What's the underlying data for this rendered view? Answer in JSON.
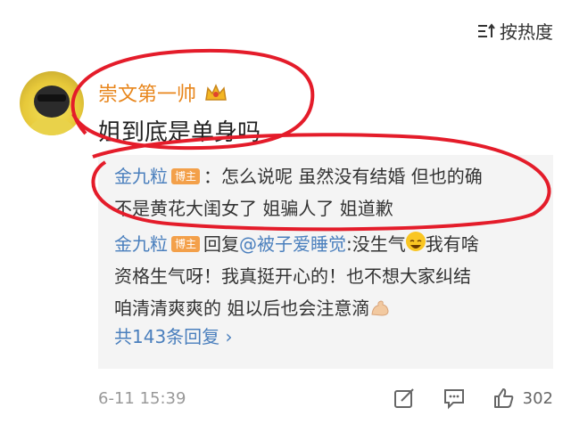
{
  "sort_button": {
    "label": "按热度",
    "icon": "sort-lines-icon"
  },
  "comment": {
    "avatar_icon": "avatar",
    "username": "崇文第一帅",
    "crown_icon": "crown-icon",
    "text": "姐到底是单身吗"
  },
  "replies": [
    {
      "name": "金九粒",
      "badge": "博主",
      "line1": "：怎么说呢 虽然没有结婚 但也的确",
      "line2": "不是黄花大闺女了 姐骗人了 姐道歉"
    },
    {
      "name": "金九粒",
      "badge": "博主",
      "reply_prefix": "回复",
      "mention": "@被子爱睡觉",
      "line1_tail": ":没生气",
      "line1_tail2": "我有啥",
      "line2": "资格生气呀！我真挺开心的！也不想大家纠结",
      "line3": "咱清清爽爽的 姐以后也会注意滴"
    }
  ],
  "more_replies": "共143条回复 ›",
  "footer": {
    "time": "6-11 15:39",
    "like_count": "302",
    "icons": [
      "share-icon",
      "comment-icon",
      "like-icon"
    ]
  },
  "colors": {
    "link": "#4a7fbd",
    "username": "#e8861c",
    "annotation": "#e41c2a",
    "badge": "#f3a04a"
  }
}
